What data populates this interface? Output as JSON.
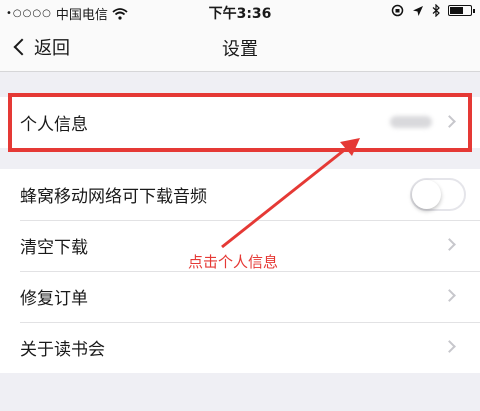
{
  "status_bar": {
    "signal": "•○○○○",
    "carrier": "中国电信",
    "time": "下午3:36"
  },
  "nav": {
    "back_label": "返回",
    "title": "设置"
  },
  "settings": {
    "personal_info": "个人信息",
    "cellular_download": "蜂窝移动网络可下载音频",
    "cellular_download_enabled": false,
    "clear_downloads": "清空下载",
    "repair_orders": "修复订单",
    "about_reading_club": "关于读书会"
  },
  "annotation": {
    "text": "点击个人信息",
    "color": "#e53935"
  },
  "icons": [
    "wifi-icon",
    "location-icon",
    "bluetooth-icon",
    "battery-icon",
    "chevron-right-icon"
  ]
}
